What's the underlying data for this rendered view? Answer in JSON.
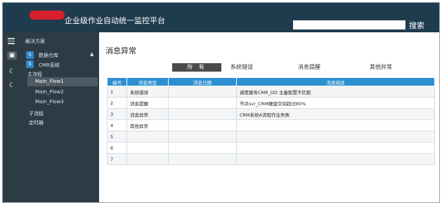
{
  "header": {
    "app_title": "企业级作业自动统一监控平台",
    "search_placeholder": "",
    "search_button": "搜索"
  },
  "sidebar": {
    "solution_label": "解决方案",
    "database_label": "数据仓库",
    "cmr_label": "CMR系统",
    "flow_heading": "主流程",
    "flows": [
      "Main_Flow1",
      "Main_Flow2",
      "Main_Flow3"
    ],
    "sub_flow_label": "子流程",
    "timer_label": "定时器"
  },
  "main": {
    "title": "消息异常",
    "tabs": [
      "所 有",
      "系统错误",
      "消息提醒",
      "其他异常"
    ],
    "active_tab": 0
  },
  "table": {
    "columns": [
      "编号",
      "消息类型",
      "消息日期",
      "消息描述"
    ],
    "rows": [
      [
        "1",
        "系统错误",
        "",
        "调度服务CMR_DD 主备配置不匹配"
      ],
      [
        "2",
        "消息提醒",
        "",
        "节点svr_CRM硬盘空间超过85%"
      ],
      [
        "3",
        "消息异常",
        "",
        "CRM系统A流程作业失败"
      ],
      [
        "4",
        "其他异常",
        "",
        ""
      ],
      [
        "5",
        "",
        "",
        ""
      ],
      [
        "6",
        "",
        "",
        ""
      ],
      [
        "7",
        "",
        "",
        ""
      ]
    ]
  },
  "colors": {
    "topbar": "#1f3c4f",
    "sidebar": "#2d3b45",
    "table_header": "#2c8fd0",
    "logo_red": "#d6202b"
  }
}
